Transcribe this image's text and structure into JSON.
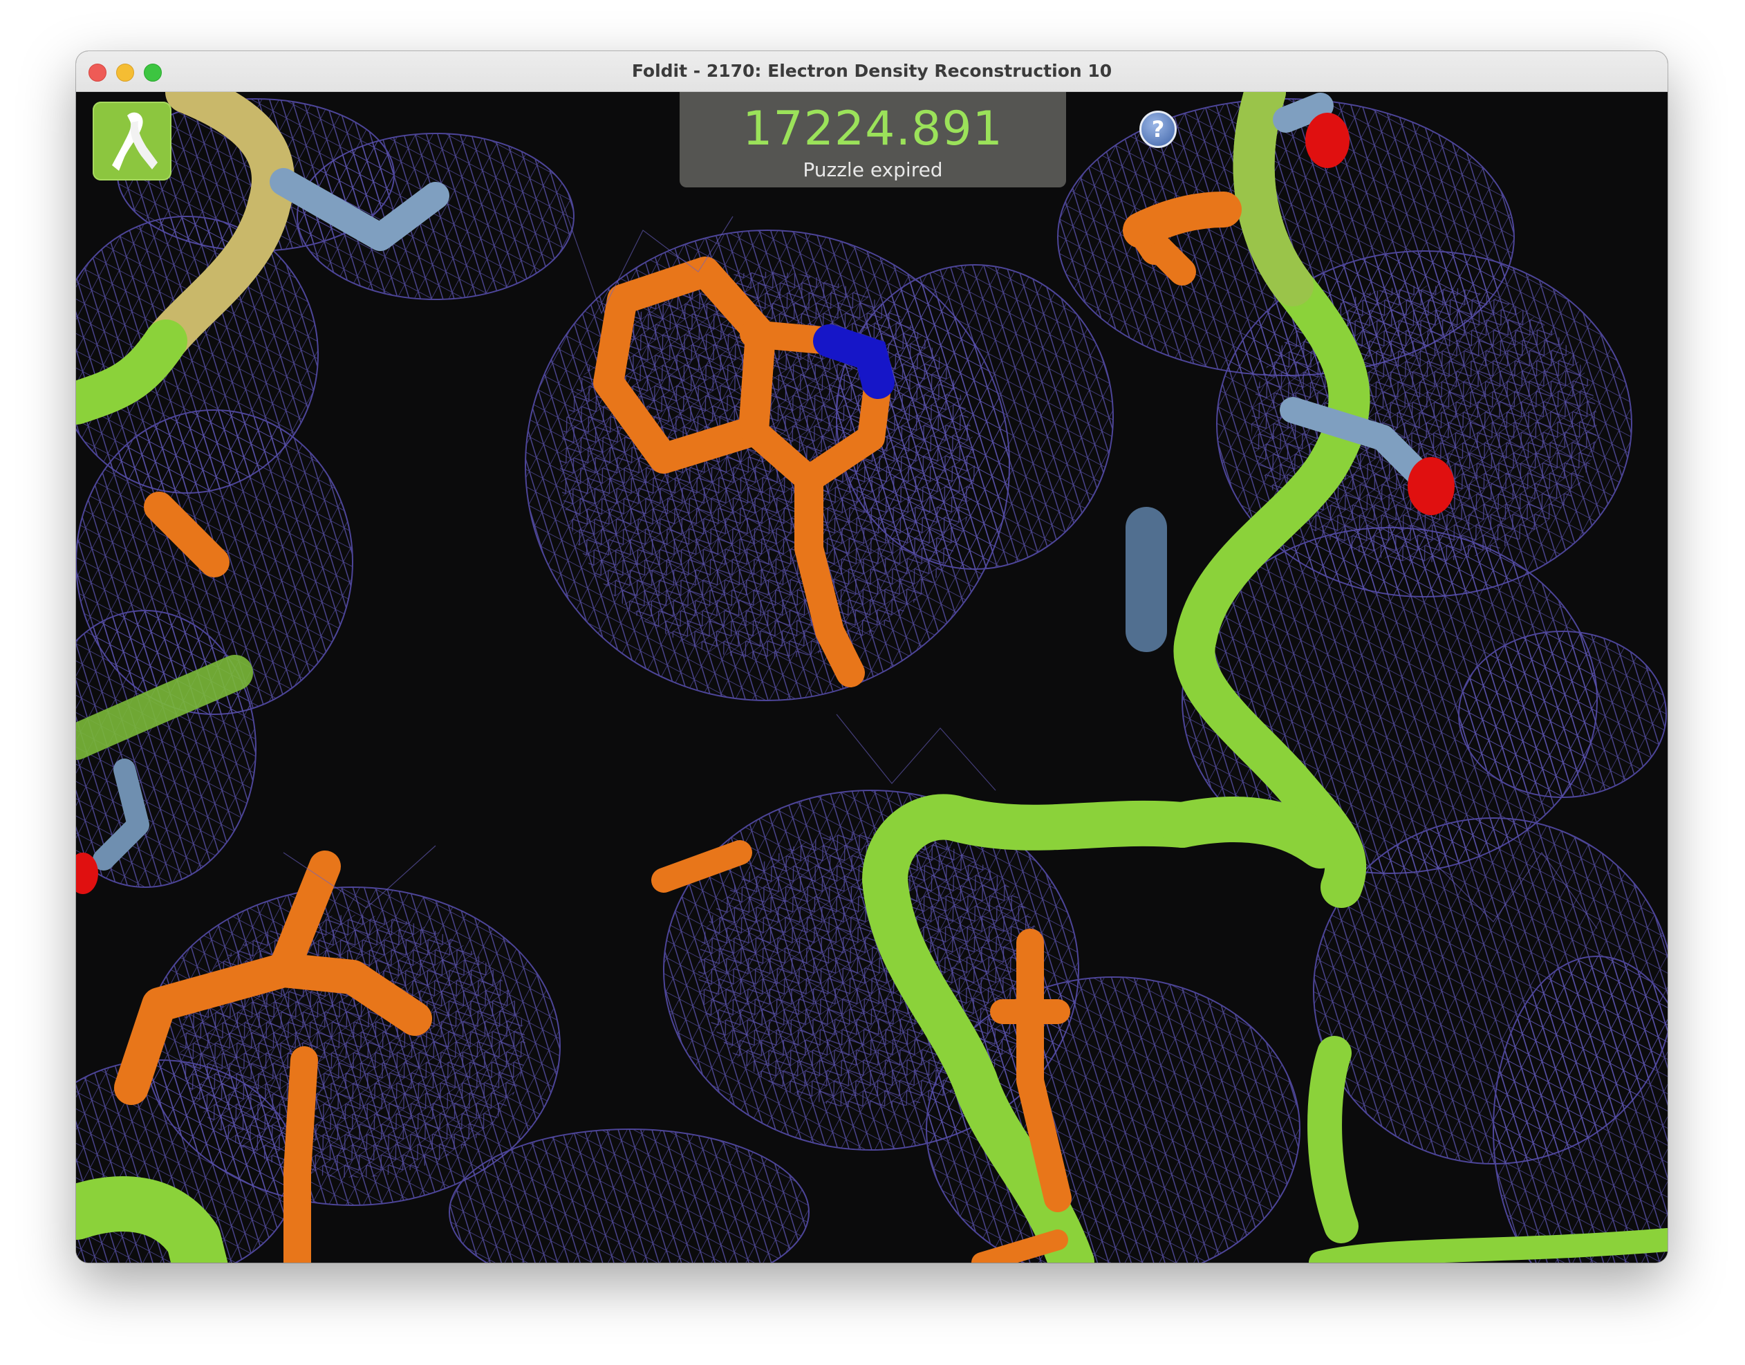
{
  "window": {
    "title": "Foldit - 2170: Electron Density Reconstruction 10"
  },
  "hud": {
    "score": "17224.891",
    "status": "Puzzle expired",
    "help_glyph": "?"
  },
  "icons": {
    "logo": "foldit-ribbon-icon",
    "help": "help-question-icon"
  },
  "colors": {
    "backbone": "#8bd23a",
    "backbone_yellow": "#c9b86a",
    "sidechain_carbon": "#e8761a",
    "nitrogen": "#1616c8",
    "oxygen": "#e01010",
    "polar": "#7f9fc0",
    "density_mesh": "#5c53b0",
    "score_text": "#9be25a"
  }
}
